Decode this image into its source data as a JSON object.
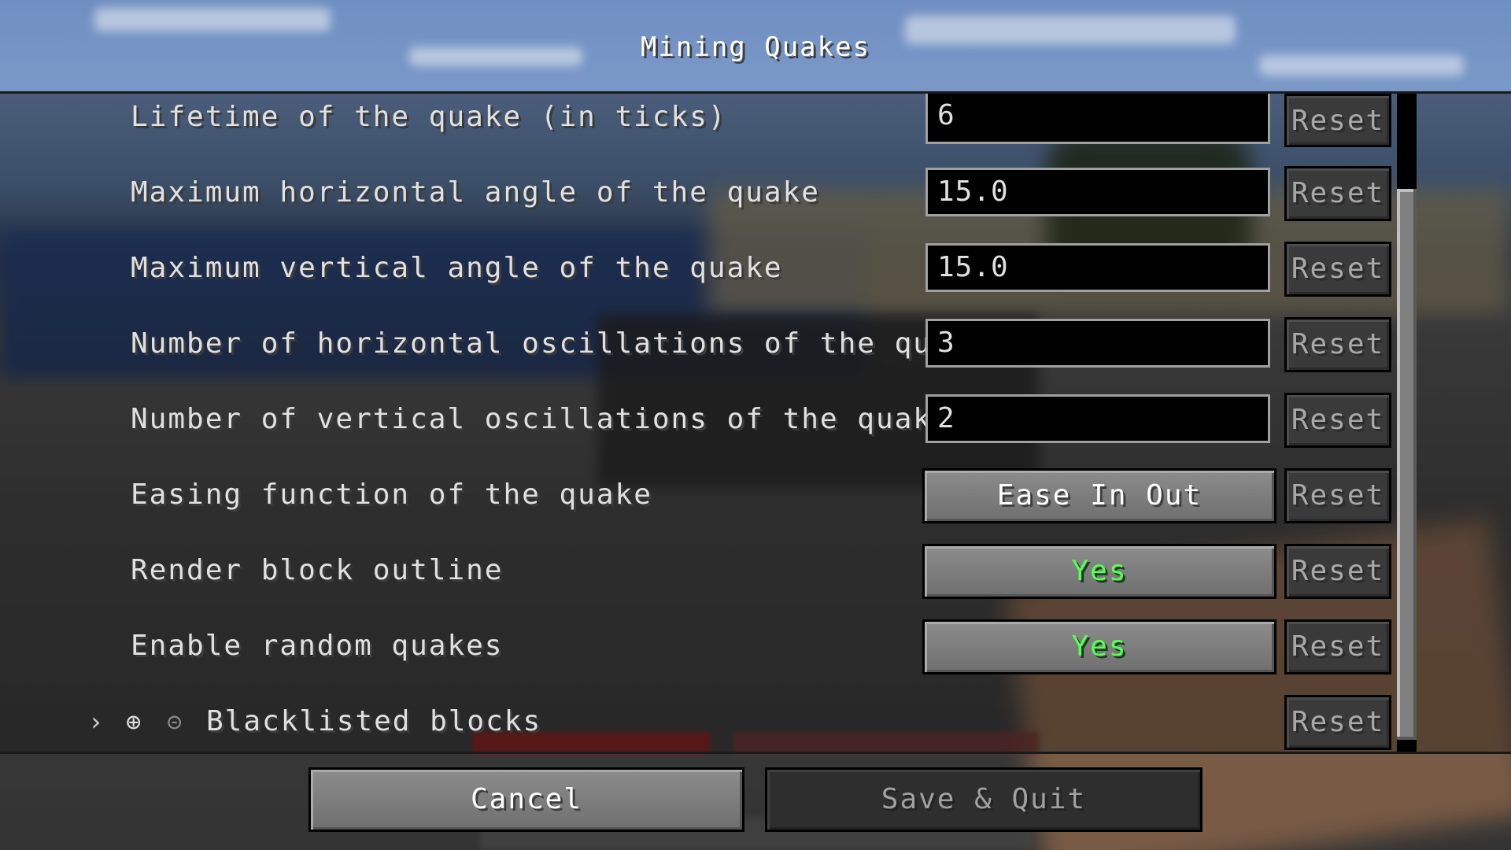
{
  "screen": {
    "title": "Mining Quakes"
  },
  "options": [
    {
      "label": "Lifetime of the quake (in ticks)",
      "type": "text",
      "value": "6",
      "reset": "Reset"
    },
    {
      "label": "Maximum horizontal angle of the quake",
      "type": "text",
      "value": "15.0",
      "reset": "Reset"
    },
    {
      "label": "Maximum vertical angle of the quake",
      "type": "text",
      "value": "15.0",
      "reset": "Reset"
    },
    {
      "label": "Number of horizontal oscillations of the quake",
      "type": "text",
      "value": "3",
      "reset": "Reset"
    },
    {
      "label": "Number of vertical oscillations of the quake",
      "type": "text",
      "value": "2",
      "reset": "Reset"
    },
    {
      "label": "Easing function of the quake",
      "type": "button",
      "value": "Ease In Out",
      "reset": "Reset"
    },
    {
      "label": "Render block outline",
      "type": "toggle",
      "value": "Yes",
      "reset": "Reset"
    },
    {
      "label": "Enable random quakes",
      "type": "toggle",
      "value": "Yes",
      "reset": "Reset"
    },
    {
      "label": "Blacklisted blocks",
      "type": "list",
      "reset": "Reset",
      "icons": {
        "expand": "chevron-right-icon",
        "add": "plus-circle-icon",
        "remove": "minus-circle-icon"
      }
    }
  ],
  "footer": {
    "cancel": "Cancel",
    "save": "Save & Quit"
  },
  "colors": {
    "toggle_on": "#55ff55",
    "text": "#e0e0e0",
    "disabled_text": "#a0a0a0"
  },
  "scrollbar": {
    "scroll_fraction": 0.0
  }
}
